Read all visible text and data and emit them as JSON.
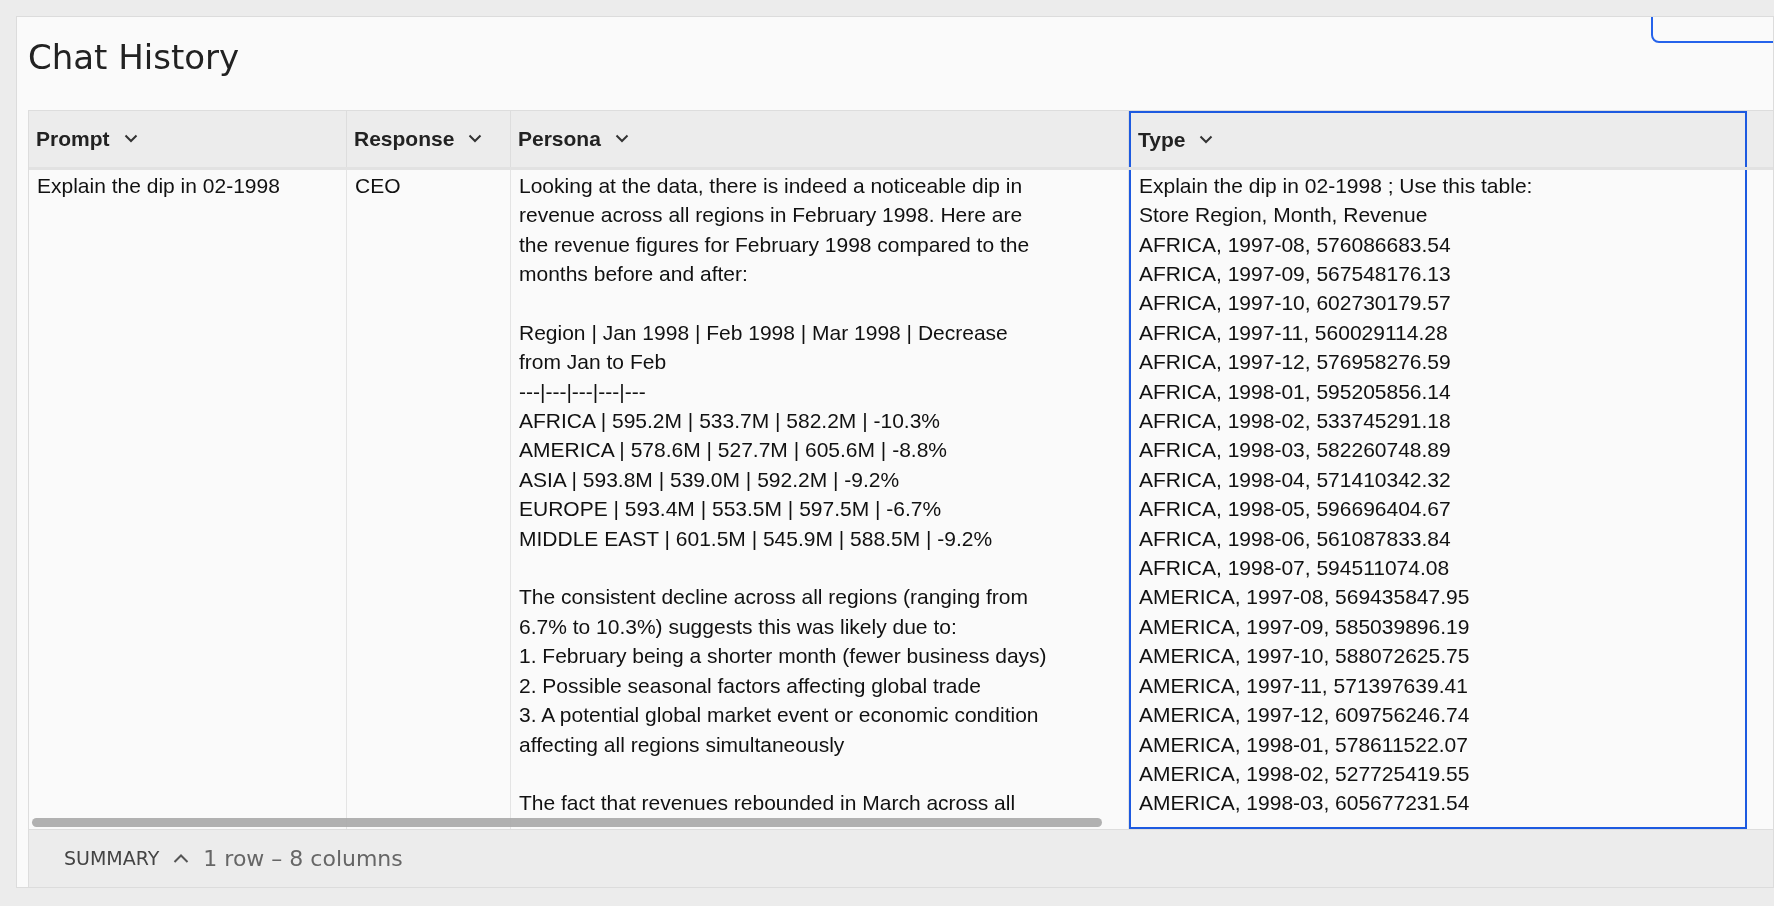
{
  "title": "Chat History",
  "table": {
    "columns": [
      {
        "label": "Prompt",
        "selected": false
      },
      {
        "label": "Response",
        "selected": false
      },
      {
        "label": "Persona",
        "selected": false
      },
      {
        "label": "Type",
        "selected": true
      }
    ],
    "rows": [
      {
        "cells": [
          "Explain the dip in 02-1998",
          "CEO",
          "Looking at the data, there is indeed a noticeable dip in\nrevenue across all regions in February 1998. Here are\nthe revenue figures for February 1998 compared to the\nmonths before and after:\n\nRegion | Jan 1998 | Feb 1998 | Mar 1998 | Decrease\nfrom Jan to Feb\n---|---|---|---|---\nAFRICA | 595.2M | 533.7M | 582.2M | -10.3%\nAMERICA | 578.6M | 527.7M | 605.6M | -8.8%\nASIA | 593.8M | 539.0M | 592.2M | -9.2%\nEUROPE | 593.4M | 553.5M | 597.5M | -6.7%\nMIDDLE EAST | 601.5M | 545.9M | 588.5M | -9.2%\n\nThe consistent decline across all regions (ranging from\n6.7% to 10.3%) suggests this was likely due to:\n1. February being a shorter month (fewer business days)\n2. Possible seasonal factors affecting global trade\n3. A potential global market event or economic condition\naffecting all regions simultaneously\n\nThe fact that revenues rebounded in March across all",
          "Explain the dip in 02-1998 ; Use this table:\nStore Region, Month, Revenue\nAFRICA, 1997-08, 576086683.54\nAFRICA, 1997-09, 567548176.13\nAFRICA, 1997-10, 602730179.57\nAFRICA, 1997-11, 560029114.28\nAFRICA, 1997-12, 576958276.59\nAFRICA, 1998-01, 595205856.14\nAFRICA, 1998-02, 533745291.18\nAFRICA, 1998-03, 582260748.89\nAFRICA, 1998-04, 571410342.32\nAFRICA, 1998-05, 596696404.67\nAFRICA, 1998-06, 561087833.84\nAFRICA, 1998-07, 594511074.08\nAMERICA, 1997-08, 569435847.95\nAMERICA, 1997-09, 585039896.19\nAMERICA, 1997-10, 588072625.75\nAMERICA, 1997-11, 571397639.41\nAMERICA, 1997-12, 609756246.74\nAMERICA, 1998-01, 578611522.07\nAMERICA, 1998-02, 527725419.55\nAMERICA, 1998-03, 605677231.54"
        ]
      }
    ]
  },
  "summary": {
    "label": "SUMMARY",
    "expanded": false,
    "text": "1 row – 8 columns"
  }
}
